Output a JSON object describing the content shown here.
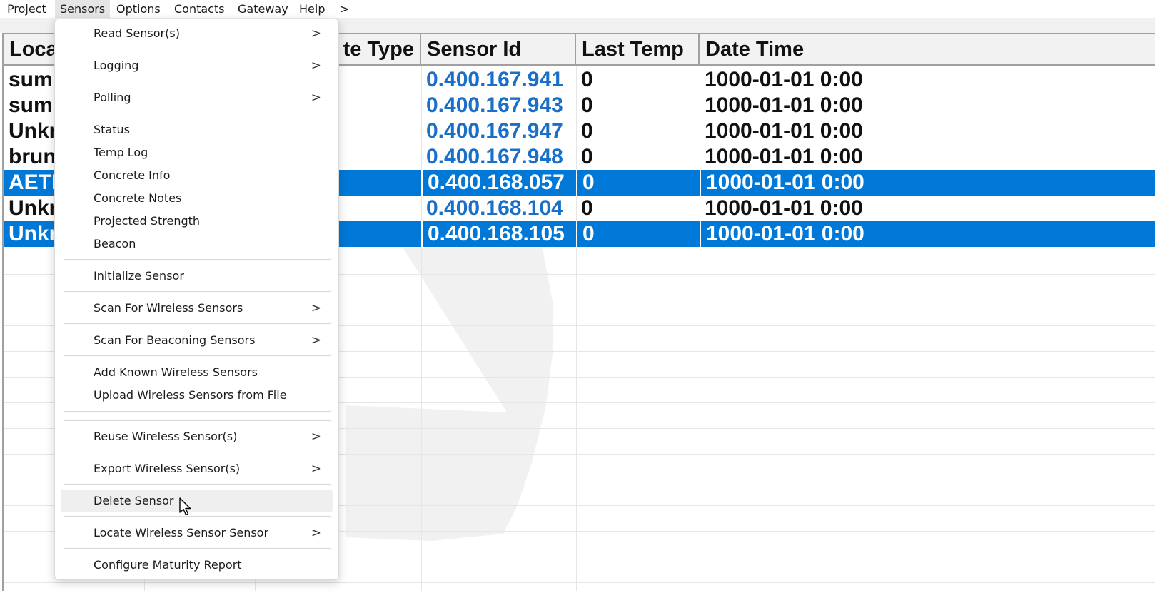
{
  "menubar": {
    "items": [
      "Project",
      "Sensors",
      "Options",
      "Contacts",
      "Gateway",
      "Help",
      ">"
    ],
    "active": "Sensors"
  },
  "grid": {
    "columns": [
      "Loca",
      "te Type",
      "Sensor Id",
      "Last Temp",
      "Date Time"
    ],
    "rows": [
      {
        "location": "sum",
        "sensor_id": "0.400.167.941",
        "last_temp": "0",
        "date_time": "1000-01-01 0:00",
        "selected": false
      },
      {
        "location": "sum",
        "sensor_id": "0.400.167.943",
        "last_temp": "0",
        "date_time": "1000-01-01 0:00",
        "selected": false
      },
      {
        "location": "Unkr",
        "sensor_id": "0.400.167.947",
        "last_temp": "0",
        "date_time": "1000-01-01 0:00",
        "selected": false
      },
      {
        "location": "brun",
        "sensor_id": "0.400.167.948",
        "last_temp": "0",
        "date_time": "1000-01-01 0:00",
        "selected": false
      },
      {
        "location": "AETI",
        "sensor_id": "0.400.168.057",
        "last_temp": "0",
        "date_time": "1000-01-01 0:00",
        "selected": true
      },
      {
        "location": "Unkr",
        "sensor_id": "0.400.168.104",
        "last_temp": "0",
        "date_time": "1000-01-01 0:00",
        "selected": false
      },
      {
        "location": "Unkr",
        "sensor_id": "0.400.168.105",
        "last_temp": "0",
        "date_time": "1000-01-01 0:00",
        "selected": true
      }
    ]
  },
  "sensors_menu": {
    "read_sensors": "Read Sensor(s)",
    "logging": "Logging",
    "polling": "Polling",
    "status": "Status",
    "temp_log": "Temp Log",
    "concrete_info": "Concrete Info",
    "concrete_notes": "Concrete Notes",
    "projected_strength": "Projected Strength",
    "beacon": "Beacon",
    "initialize_sensor": "Initialize Sensor",
    "scan_wireless": "Scan For Wireless Sensors",
    "scan_beaconing": "Scan For Beaconing Sensors",
    "add_known": "Add Known Wireless Sensors",
    "upload_from_file": "Upload Wireless Sensors from File",
    "reuse_wireless": "Reuse Wireless Sensor(s)",
    "export_wireless": "Export Wireless Sensor(s)",
    "delete_sensor": "Delete Sensor",
    "locate_wireless": "Locate Wireless Sensor Sensor",
    "configure_maturity": "Configure Maturity Report",
    "submenu_arrow": ">"
  },
  "colors": {
    "selection": "#0078d7",
    "sensor_id_text": "#1a6fc9",
    "menu_hover": "#efefef"
  }
}
